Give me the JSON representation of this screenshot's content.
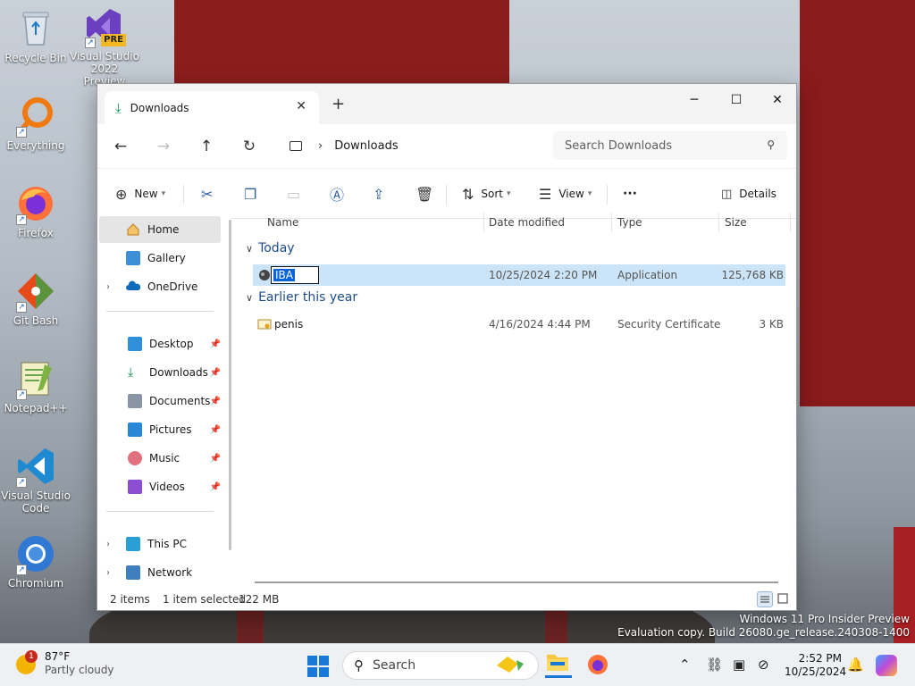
{
  "desktop": {
    "icons": [
      {
        "label": "Recycle Bin"
      },
      {
        "label": "Visual Studio 2022 Preview",
        "badge": "PRE"
      },
      {
        "label": "Everything"
      },
      {
        "label": "Firefox"
      },
      {
        "label": "Git Bash"
      },
      {
        "label": "Notepad++"
      },
      {
        "label": "Visual Studio Code"
      },
      {
        "label": "Chromium"
      }
    ]
  },
  "window": {
    "tab_title": "Downloads",
    "new_tab": "+",
    "controls": {
      "minimize": "─",
      "maximize": "☐",
      "close": "✕"
    },
    "nav": {
      "back": "←",
      "forward": "→",
      "up": "↑",
      "refresh": "↻",
      "breadcrumb": "Downloads",
      "breadcrumb_sep": "›",
      "search_placeholder": "Search Downloads"
    },
    "toolbar": {
      "new_label": "New",
      "sort_label": "Sort",
      "view_label": "View",
      "more_label": "···",
      "details_label": "Details"
    },
    "sidebar": {
      "items": [
        {
          "label": "Home"
        },
        {
          "label": "Gallery"
        },
        {
          "label": "OneDrive"
        },
        {
          "label": "Desktop"
        },
        {
          "label": "Downloads"
        },
        {
          "label": "Documents"
        },
        {
          "label": "Pictures"
        },
        {
          "label": "Music"
        },
        {
          "label": "Videos"
        },
        {
          "label": "This PC"
        },
        {
          "label": "Network"
        }
      ]
    },
    "columns": {
      "name": "Name",
      "date": "Date modified",
      "type": "Type",
      "size": "Size"
    },
    "groups": [
      {
        "title": "Today",
        "files": [
          {
            "name": "IBA",
            "date": "10/25/2024 2:20 PM",
            "type": "Application",
            "size": "125,768 KB"
          }
        ]
      },
      {
        "title": "Earlier this year",
        "files": [
          {
            "name": "penis",
            "date": "4/16/2024 4:44 PM",
            "type": "Security Certificate",
            "size": "3 KB"
          }
        ]
      }
    ],
    "status": {
      "items": "2 items",
      "selected": "1 item selected",
      "size": "122 MB"
    }
  },
  "watermark": {
    "line1": "Windows 11 Pro Insider Preview",
    "line2": "Evaluation copy. Build 26080.ge_release.240308-1400"
  },
  "taskbar": {
    "weather": {
      "temp": "87°F",
      "condition": "Partly cloudy",
      "badge": "1"
    },
    "search_placeholder": "Search",
    "time": "2:52 PM",
    "date": "10/25/2024"
  },
  "colors": {
    "accent": "#0a64d8",
    "selection": "#cce4f7",
    "flag_red": "#8c1d1d"
  }
}
